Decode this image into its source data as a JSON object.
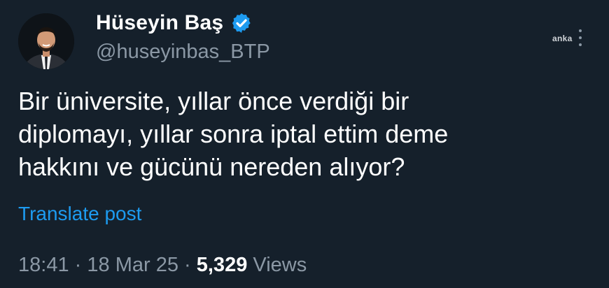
{
  "author": {
    "display_name": "Hüseyin Baş",
    "handle": "@huseyinbas_BTP",
    "verified": true,
    "avatar_icon": "profile-photo"
  },
  "watermark": "anka",
  "more_menu_icon": "more-vertical-icon",
  "tweet": {
    "lines": [
      "Bir üniversite, yıllar önce verdiği bir",
      "diplomayı, yıllar sonra iptal ettim deme",
      "hakkını ve gücünü nereden alıyor?"
    ],
    "translate_label": "Translate post"
  },
  "meta": {
    "time": "18:41",
    "separator": "·",
    "date": "18 Mar 25",
    "views_count": "5,329",
    "views_label": "Views"
  },
  "colors": {
    "background": "#15202b",
    "text": "#ffffff",
    "secondary_text": "#8b98a5",
    "link": "#1d9bf0",
    "verified_badge": "#1d9bf0"
  }
}
